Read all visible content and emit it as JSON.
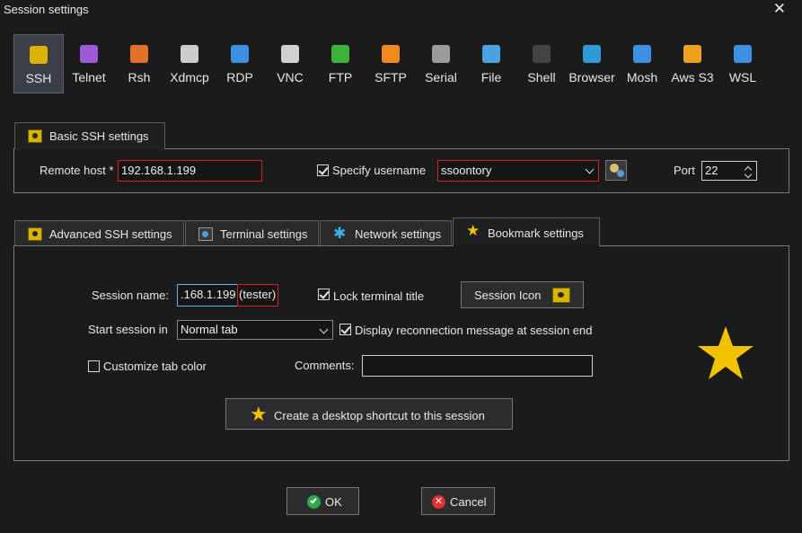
{
  "window": {
    "title": "Session settings",
    "close_glyph": "✕"
  },
  "session_types": [
    {
      "label": "SSH",
      "icon": "ssh-key-icon",
      "color": "#d9b300",
      "selected": true
    },
    {
      "label": "Telnet",
      "icon": "telnet-icon",
      "color": "#9c5ad6"
    },
    {
      "label": "Rsh",
      "icon": "rsh-icon",
      "color": "#e0702a"
    },
    {
      "label": "Xdmcp",
      "icon": "xdmcp-icon",
      "color": "#cccccc"
    },
    {
      "label": "RDP",
      "icon": "rdp-icon",
      "color": "#3d8fe0"
    },
    {
      "label": "VNC",
      "icon": "vnc-icon",
      "color": "#d0d0d0"
    },
    {
      "label": "FTP",
      "icon": "ftp-icon",
      "color": "#3cb43c"
    },
    {
      "label": "SFTP",
      "icon": "sftp-icon",
      "color": "#f08a1e"
    },
    {
      "label": "Serial",
      "icon": "serial-icon",
      "color": "#9a9a9a"
    },
    {
      "label": "File",
      "icon": "file-icon",
      "color": "#4aa3e0"
    },
    {
      "label": "Shell",
      "icon": "shell-icon",
      "color": "#444444"
    },
    {
      "label": "Browser",
      "icon": "browser-icon",
      "color": "#2f9ad8"
    },
    {
      "label": "Mosh",
      "icon": "mosh-icon",
      "color": "#3d8fe0"
    },
    {
      "label": "Aws S3",
      "icon": "aws-s3-icon",
      "color": "#f0a020"
    },
    {
      "label": "WSL",
      "icon": "wsl-icon",
      "color": "#3d8fe0"
    }
  ],
  "basic": {
    "tab_label": "Basic SSH settings",
    "remote_host_label": "Remote host *",
    "remote_host_value": "192.168.1.199",
    "specify_username_label": "Specify username",
    "specify_username_checked": true,
    "username_value": "ssoontory",
    "port_label": "Port",
    "port_value": "22"
  },
  "sub_tabs": [
    {
      "label": "Advanced SSH settings",
      "icon": "wrench-icon"
    },
    {
      "label": "Terminal settings",
      "icon": "terminal-icon"
    },
    {
      "label": "Network settings",
      "icon": "network-icon"
    },
    {
      "label": "Bookmark settings",
      "icon": "star-icon",
      "active": true
    }
  ],
  "bookmark": {
    "session_name_label": "Session name:",
    "session_name_value": ".168.1.199 (tester)",
    "lock_title_label": "Lock terminal title",
    "lock_title_checked": true,
    "session_icon_label": "Session Icon",
    "start_session_label": "Start session in",
    "start_session_value": "Normal tab",
    "reconnect_label": "Display reconnection message at session end",
    "reconnect_checked": true,
    "customize_tab_color_label": "Customize tab color",
    "customize_tab_color_checked": false,
    "comments_label": "Comments:",
    "comments_value": "",
    "shortcut_label": "Create a desktop shortcut to this session"
  },
  "footer": {
    "ok_label": "OK",
    "cancel_label": "Cancel"
  },
  "colors": {
    "accent_star": "#f2c200",
    "error_red": "#d82020",
    "ok_green": "#2ea84a",
    "cancel_red": "#e03030"
  }
}
